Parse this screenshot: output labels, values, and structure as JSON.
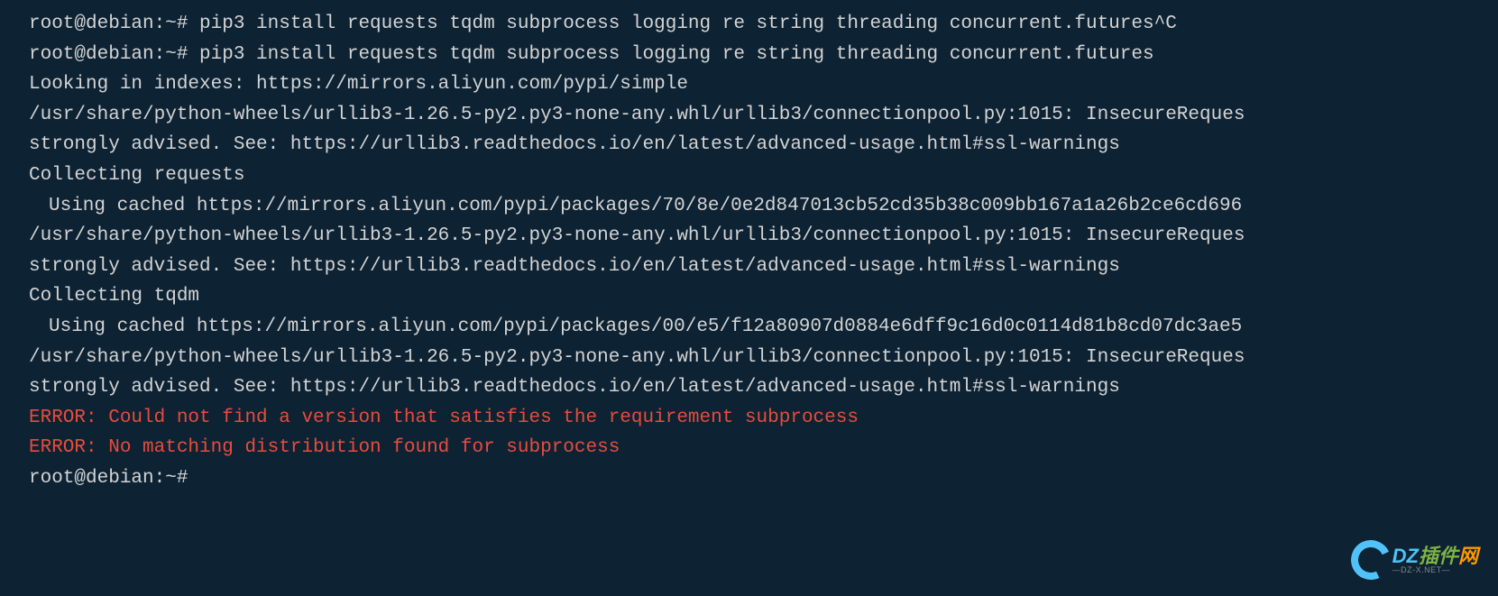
{
  "terminal": {
    "lines": [
      {
        "cls": "",
        "text": "root@debian:~# pip3 install requests tqdm subprocess logging re string threading concurrent.futures^C"
      },
      {
        "cls": "",
        "text": "root@debian:~# pip3 install requests tqdm subprocess logging re string threading concurrent.futures"
      },
      {
        "cls": "",
        "text": "Looking in indexes: https://mirrors.aliyun.com/pypi/simple"
      },
      {
        "cls": "",
        "text": "/usr/share/python-wheels/urllib3-1.26.5-py2.py3-none-any.whl/urllib3/connectionpool.py:1015: InsecureReques"
      },
      {
        "cls": "",
        "text": "strongly advised. See: https://urllib3.readthedocs.io/en/latest/advanced-usage.html#ssl-warnings"
      },
      {
        "cls": "",
        "text": "Collecting requests"
      },
      {
        "cls": "indent",
        "text": "Using cached https://mirrors.aliyun.com/pypi/packages/70/8e/0e2d847013cb52cd35b38c009bb167a1a26b2ce6cd696"
      },
      {
        "cls": "",
        "text": "/usr/share/python-wheels/urllib3-1.26.5-py2.py3-none-any.whl/urllib3/connectionpool.py:1015: InsecureReques"
      },
      {
        "cls": "",
        "text": "strongly advised. See: https://urllib3.readthedocs.io/en/latest/advanced-usage.html#ssl-warnings"
      },
      {
        "cls": "",
        "text": "Collecting tqdm"
      },
      {
        "cls": "indent",
        "text": "Using cached https://mirrors.aliyun.com/pypi/packages/00/e5/f12a80907d0884e6dff9c16d0c0114d81b8cd07dc3ae5"
      },
      {
        "cls": "",
        "text": "/usr/share/python-wheels/urllib3-1.26.5-py2.py3-none-any.whl/urllib3/connectionpool.py:1015: InsecureReques"
      },
      {
        "cls": "",
        "text": "strongly advised. See: https://urllib3.readthedocs.io/en/latest/advanced-usage.html#ssl-warnings"
      },
      {
        "cls": "error",
        "text": "ERROR: Could not find a version that satisfies the requirement subprocess"
      },
      {
        "cls": "error",
        "text": "ERROR: No matching distribution found for subprocess"
      },
      {
        "cls": "",
        "text": "root@debian:~#"
      }
    ]
  },
  "logo": {
    "main_dz": "DZ",
    "main_cj": "插件",
    "main_w": "网",
    "sub": "—DZ-X.NET—"
  }
}
